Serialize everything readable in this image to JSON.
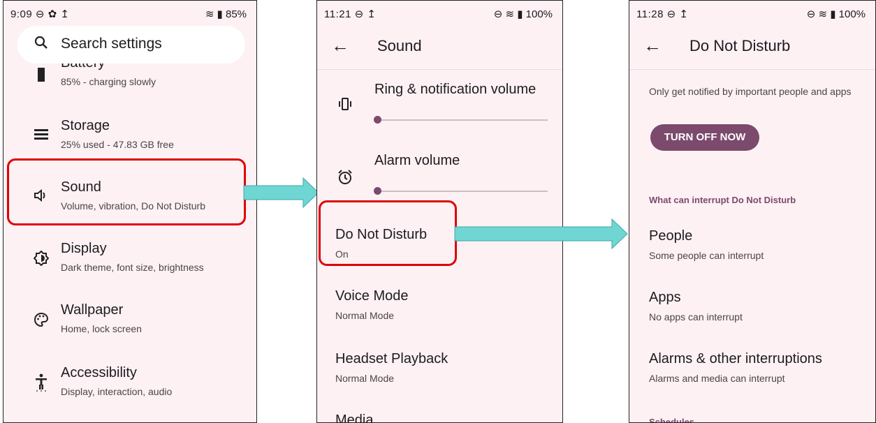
{
  "colors": {
    "accent": "#7b4a6d",
    "highlight": "#e00000",
    "arrow": "#6fd6d3",
    "background": "#fdf1f4"
  },
  "screen1": {
    "status_left": "9:09 ⊖ ✿ ↥",
    "status_right": "≋ ▮ 85%",
    "search_placeholder": "Search settings",
    "items": [
      {
        "title": "Battery",
        "subtitle": "85% - charging slowly",
        "icon": "battery-icon"
      },
      {
        "title": "Storage",
        "subtitle": "25% used - 47.83 GB free",
        "icon": "storage-icon"
      },
      {
        "title": "Sound",
        "subtitle": "Volume, vibration, Do Not Disturb",
        "icon": "volume-icon"
      },
      {
        "title": "Display",
        "subtitle": "Dark theme, font size, brightness",
        "icon": "brightness-icon"
      },
      {
        "title": "Wallpaper",
        "subtitle": "Home, lock screen",
        "icon": "palette-icon"
      },
      {
        "title": "Accessibility",
        "subtitle": "Display, interaction, audio",
        "icon": "accessibility-icon"
      }
    ]
  },
  "screen2": {
    "status_left": "11:21 ⊖ ↥",
    "status_right": "⊖ ≋ ▮ 100%",
    "back": "←",
    "title": "Sound",
    "ring_label": "Ring & notification volume",
    "alarm_label": "Alarm volume",
    "dnd_title": "Do Not Disturb",
    "dnd_subtitle": "On",
    "voice_title": "Voice Mode",
    "voice_subtitle": "Normal Mode",
    "headset_title": "Headset Playback",
    "headset_subtitle": "Normal Mode",
    "media_title": "Media",
    "ring_level": 0,
    "alarm_level": 0
  },
  "screen3": {
    "status_left": "11:28 ⊖ ↥",
    "status_right": "⊖ ≋ ▮ 100%",
    "back": "←",
    "title": "Do Not Disturb",
    "description": "Only get notified by important people and apps",
    "button": "TURN OFF NOW",
    "section": "What can interrupt Do Not Disturb",
    "people_title": "People",
    "people_subtitle": "Some people can interrupt",
    "apps_title": "Apps",
    "apps_subtitle": "No apps can interrupt",
    "alarms_title": "Alarms & other interruptions",
    "alarms_subtitle": "Alarms and media can interrupt",
    "schedules": "Schedules"
  }
}
